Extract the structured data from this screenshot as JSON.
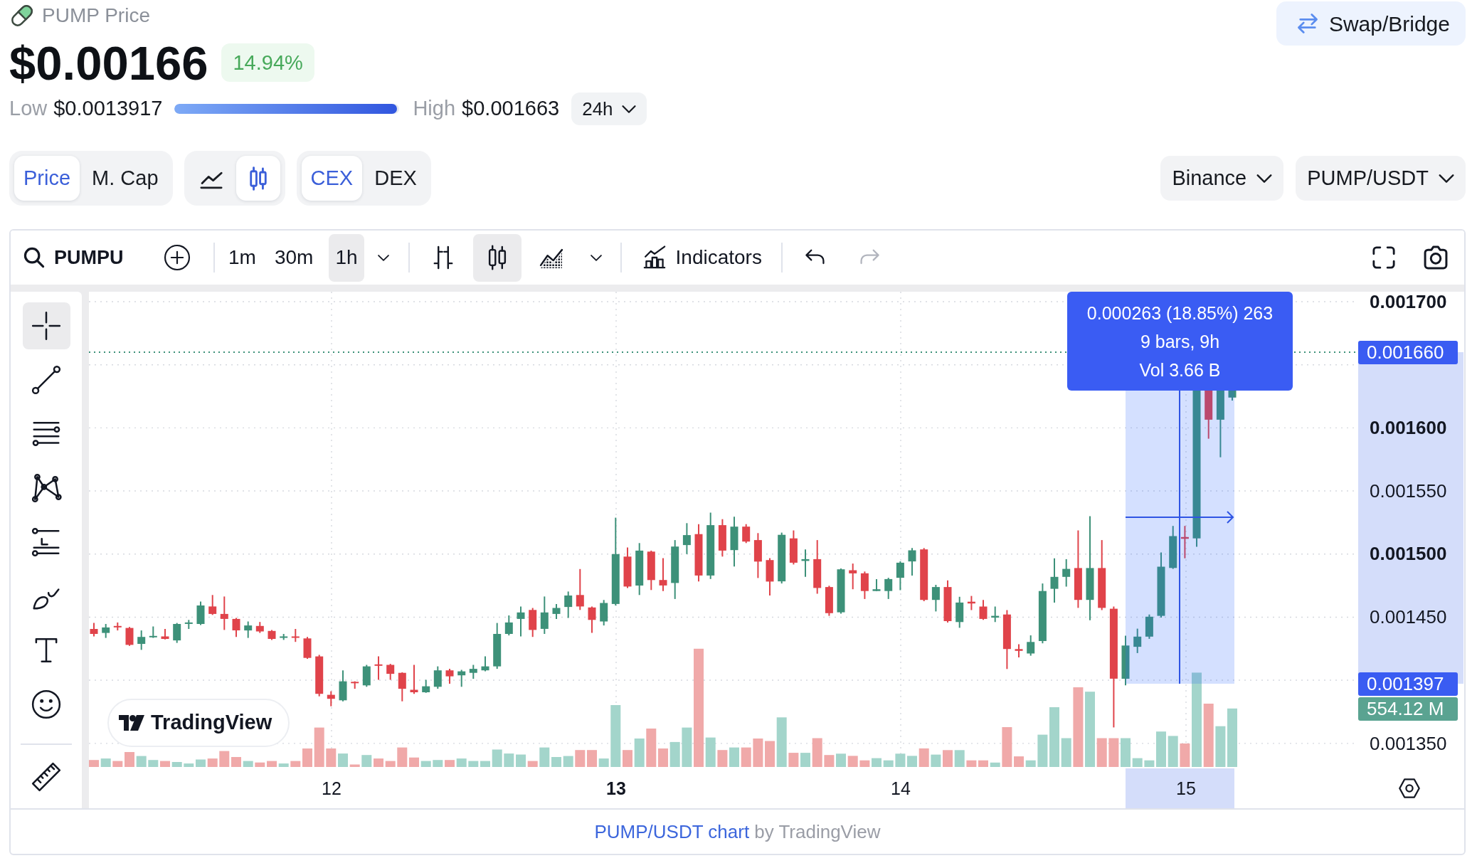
{
  "header": {
    "title": "PUMP Price",
    "price": "$0.00166",
    "change": {
      "text": "14.94%",
      "positive": true
    },
    "swap_button": "Swap/Bridge"
  },
  "range": {
    "low_label": "Low",
    "low": "$0.0013917",
    "level": 0.99,
    "high_label": "High",
    "high": "$0.001663",
    "period": "24h"
  },
  "toggle_groups": [
    {
      "items": [
        {
          "kind": "text",
          "label": "Price",
          "selected": true
        },
        {
          "kind": "text",
          "label": "M. Cap",
          "selected": false
        }
      ]
    },
    {
      "items": [
        {
          "kind": "line-icon",
          "selected": false
        },
        {
          "kind": "candles-icon",
          "selected": true
        }
      ]
    },
    {
      "items": [
        {
          "kind": "text",
          "label": "CEX",
          "selected": true
        },
        {
          "kind": "text",
          "label": "DEX",
          "selected": false
        }
      ]
    }
  ],
  "market_selectors": [
    "Binance",
    "PUMP/USDT"
  ],
  "chart_toolbar": {
    "symbol": "PUMPU",
    "intervals": [
      {
        "label": "1m",
        "selected": false
      },
      {
        "label": "30m",
        "selected": false
      },
      {
        "label": "1h",
        "selected": true
      }
    ],
    "chart_types": [
      {
        "kind": "bars",
        "selected": false
      },
      {
        "kind": "candles",
        "selected": true
      },
      {
        "kind": "area",
        "selected": false
      }
    ],
    "indicators": "Indicators",
    "history": [
      {
        "kind": "undo",
        "disabled": false
      },
      {
        "kind": "redo",
        "disabled": true
      }
    ]
  },
  "drawing_tools": [
    {
      "kind": "crosshair",
      "selected": true
    },
    {
      "kind": "trend-line",
      "selected": false
    },
    {
      "kind": "parallel-lines",
      "selected": false
    },
    {
      "kind": "pattern",
      "selected": false
    },
    {
      "kind": "projection",
      "selected": false
    },
    {
      "kind": "brush",
      "selected": false
    },
    {
      "kind": "text",
      "selected": false
    },
    {
      "kind": "emoji",
      "selected": false
    },
    {
      "kind": "ruler",
      "selected": false
    }
  ],
  "chart": {
    "price_labels": [
      {
        "text": "0.001700",
        "bold": true
      },
      {
        "text": "0.001600",
        "bold": true
      },
      {
        "text": "0.001550",
        "bold": false
      },
      {
        "text": "0.001500",
        "bold": true
      },
      {
        "text": "0.001450",
        "bold": false
      },
      {
        "text": "0.001350",
        "bold": false
      }
    ],
    "price_badges": [
      {
        "text": "0.001660",
        "color": "#3a5cf2"
      },
      {
        "text": "0.001397",
        "color": "#3a5cf2"
      },
      {
        "text": "554.12 M",
        "color": "#5aa391"
      }
    ],
    "time_labels": [
      {
        "text": "12",
        "bold": false
      },
      {
        "text": "13",
        "bold": true
      },
      {
        "text": "14",
        "bold": false
      },
      {
        "text": "15",
        "bold": false
      }
    ],
    "measure_tooltip": [
      "0.000263 (18.85%) 263",
      "9 bars, 9h",
      "Vol 3.66 B"
    ],
    "logo": "TradingView"
  },
  "footer": {
    "link": "PUMP/USDT chart",
    "text": "by TradingView"
  }
}
